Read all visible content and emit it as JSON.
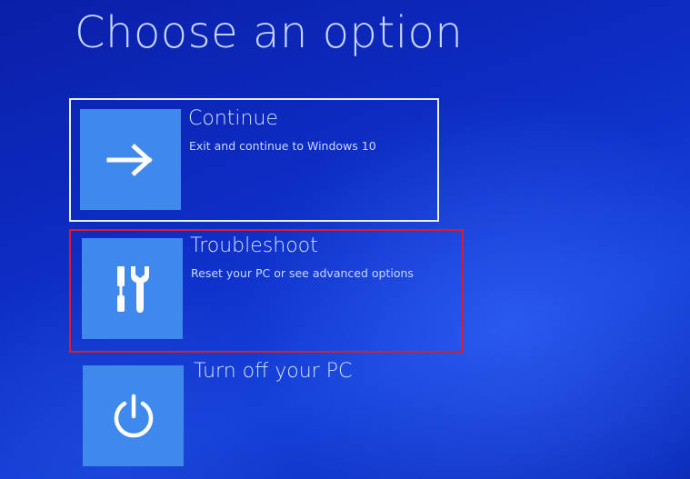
{
  "page": {
    "title": "Choose an option"
  },
  "options": [
    {
      "title": "Continue",
      "description": "Exit and continue to Windows 10",
      "icon": "arrow-right-icon"
    },
    {
      "title": "Troubleshoot",
      "description": "Reset your PC or see advanced options",
      "icon": "tools-icon"
    },
    {
      "title": "Turn off your PC",
      "description": "",
      "icon": "power-icon"
    }
  ],
  "colors": {
    "background": "#0d2dc4",
    "tile": "#3f88ec",
    "text": "#d8e2ff",
    "focus_border": "#e8efff",
    "highlight_border": "#d91d2e"
  }
}
